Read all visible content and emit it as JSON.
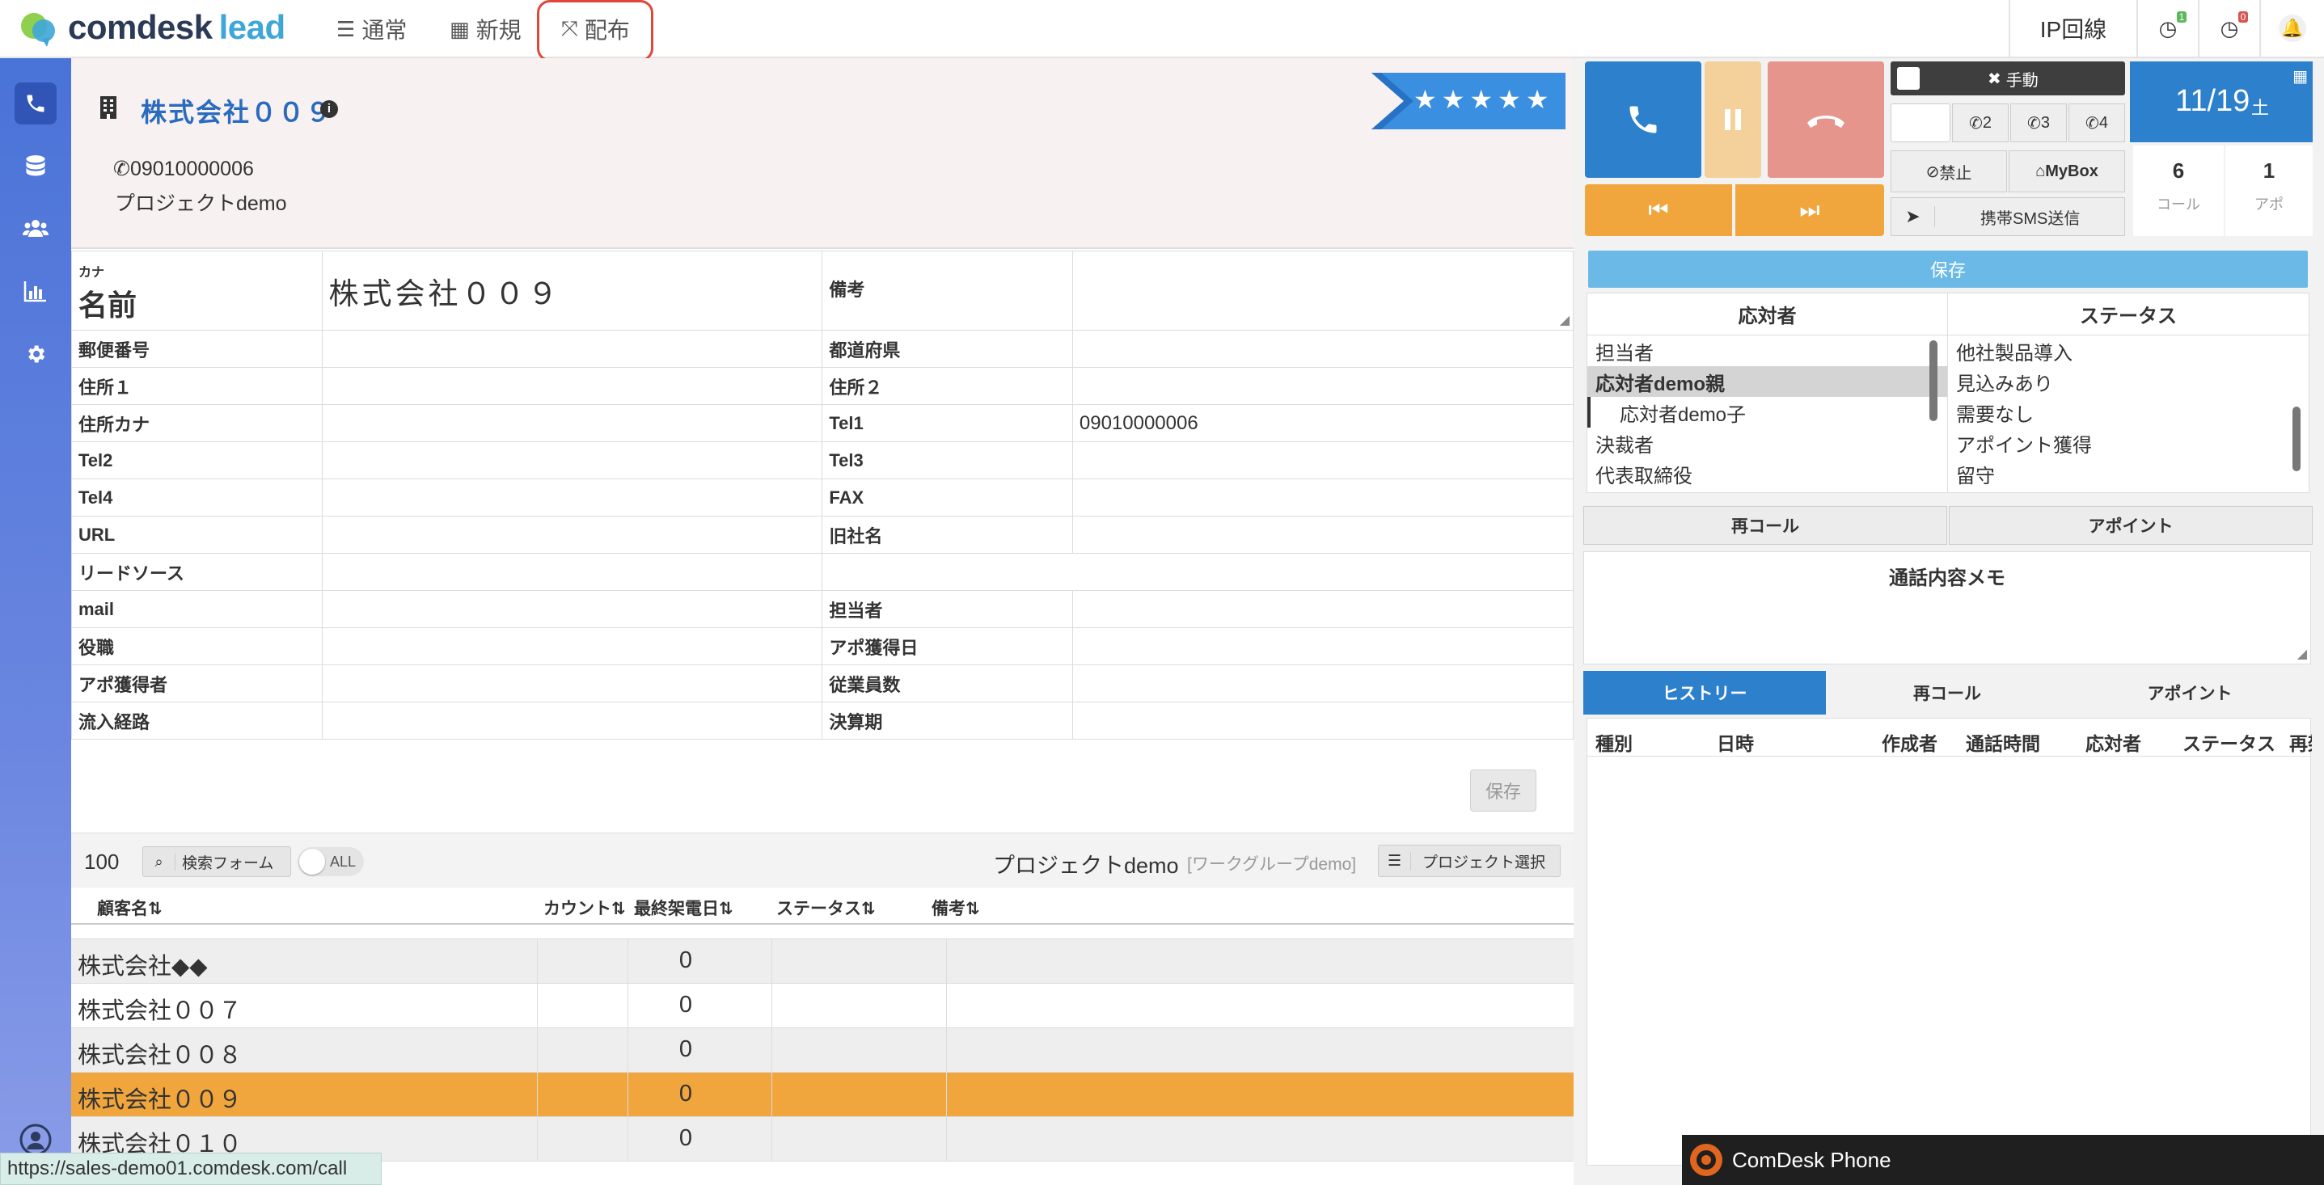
{
  "nav": {
    "logo_main": "comdesk",
    "logo_sub": "lead",
    "tabs": [
      {
        "icon": "list-icon",
        "label": "通常"
      },
      {
        "icon": "grid-icon",
        "label": "新規"
      },
      {
        "icon": "expand-icon",
        "label": "配布"
      }
    ],
    "ip_label": "IP回線",
    "timer_badge_1": "1",
    "timer_badge_2": "0"
  },
  "company": {
    "name": "株式会社００９",
    "phone": "09010000006",
    "project": "プロジェクトdemo",
    "stars": "★★★★★"
  },
  "form": {
    "kana_label": "カナ",
    "name_label": "名前",
    "name_value": "株式会社００９",
    "note_label": "備考",
    "rows": [
      {
        "l1": "郵便番号",
        "v1": "",
        "l2": "都道府県",
        "v2": ""
      },
      {
        "l1": "住所１",
        "v1": "",
        "l2": "住所２",
        "v2": ""
      },
      {
        "l1": "住所カナ",
        "v1": "",
        "l2": "Tel1",
        "v2": "09010000006"
      },
      {
        "l1": "Tel2",
        "v1": "",
        "l2": "Tel3",
        "v2": ""
      },
      {
        "l1": "Tel4",
        "v1": "",
        "l2": "FAX",
        "v2": ""
      },
      {
        "l1": "URL",
        "v1": "",
        "l2": "旧社名",
        "v2": ""
      },
      {
        "l1": "リードソース",
        "v1": "",
        "l2": "",
        "v2": ""
      },
      {
        "l1": "mail",
        "v1": "",
        "l2": "担当者",
        "v2": ""
      },
      {
        "l1": "役職",
        "v1": "",
        "l2": "アポ獲得日",
        "v2": ""
      },
      {
        "l1": "アポ獲得者",
        "v1": "",
        "l2": "従業員数",
        "v2": ""
      },
      {
        "l1": "流入経路",
        "v1": "",
        "l2": "決算期",
        "v2": ""
      }
    ],
    "save_label": "保存"
  },
  "list": {
    "count": "100",
    "search_label": "検索フォーム",
    "all_label": "ALL",
    "project_name": "プロジェクトdemo",
    "workgroup": "[ワークグループdemo]",
    "project_select": "プロジェクト選択",
    "columns": [
      "顧客名⇅",
      "カウント⇅",
      "最終架電日⇅",
      "ステータス⇅",
      "備考⇅"
    ],
    "rows": [
      {
        "name": "株式会社◆◆",
        "count": "0"
      },
      {
        "name": "株式会社００７",
        "count": "0"
      },
      {
        "name": "株式会社００８",
        "count": "0"
      },
      {
        "name": "株式会社００９",
        "count": "0"
      },
      {
        "name": "株式会社０１０",
        "count": "0"
      }
    ]
  },
  "phone": {
    "manual_label": "手動",
    "lines": [
      "2",
      "3",
      "4"
    ],
    "block_label": "禁止",
    "mybox_label": "MyBox",
    "sms_label": "携帯SMS送信",
    "date": "11/19",
    "weekday": "土",
    "call_count": "6",
    "call_label": "コール",
    "apo_count": "1",
    "apo_label": "アポ",
    "save_label": "保存",
    "responder_header": "応対者",
    "status_header": "ステータス",
    "responders": [
      "担当者",
      "応対者demo親",
      "応対者demo子",
      "決裁者",
      "代表取締役"
    ],
    "statuses": [
      "他社製品導入",
      "見込みあり",
      "需要なし",
      "アポイント獲得",
      "留守"
    ],
    "recall_btn": "再コール",
    "appoint_btn": "アポイント",
    "memo_title": "通話内容メモ",
    "tabs": [
      "ヒストリー",
      "再コール",
      "アポイント"
    ],
    "history_columns": [
      "種別",
      "日時",
      "作成者",
      "通話時間",
      "応対者",
      "ステータス",
      "再架"
    ]
  },
  "statusbar_url": "https://sales-demo01.comdesk.com/call",
  "phone_app_label": "ComDesk Phone"
}
